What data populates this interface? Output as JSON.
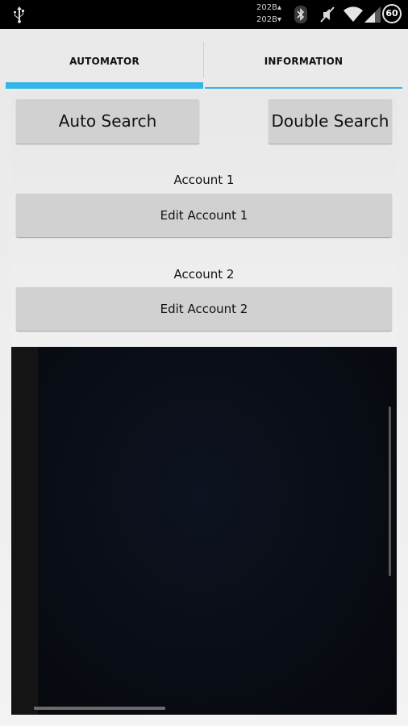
{
  "status_bar": {
    "rate_up": "202B▴",
    "rate_down": "202B▾",
    "battery_level": "60",
    "icons": [
      "usb-icon",
      "bluetooth-icon",
      "mute-icon",
      "wifi-icon",
      "cell-signal-icon",
      "battery-icon"
    ]
  },
  "tabs": [
    {
      "label": "AUTOMATOR",
      "selected": true
    },
    {
      "label": "INFORMATION",
      "selected": false
    }
  ],
  "buttons": {
    "auto_search": "Auto Search",
    "double_search": "Double Search",
    "edit_account_1": "Edit Account 1",
    "edit_account_2": "Edit Account 2"
  },
  "labels": {
    "account_1": "Account 1",
    "account_2": "Account 2"
  },
  "colors": {
    "accent": "#33b5e5",
    "button_bg": "#d1d1d1",
    "preview_bg": "#070a10"
  }
}
